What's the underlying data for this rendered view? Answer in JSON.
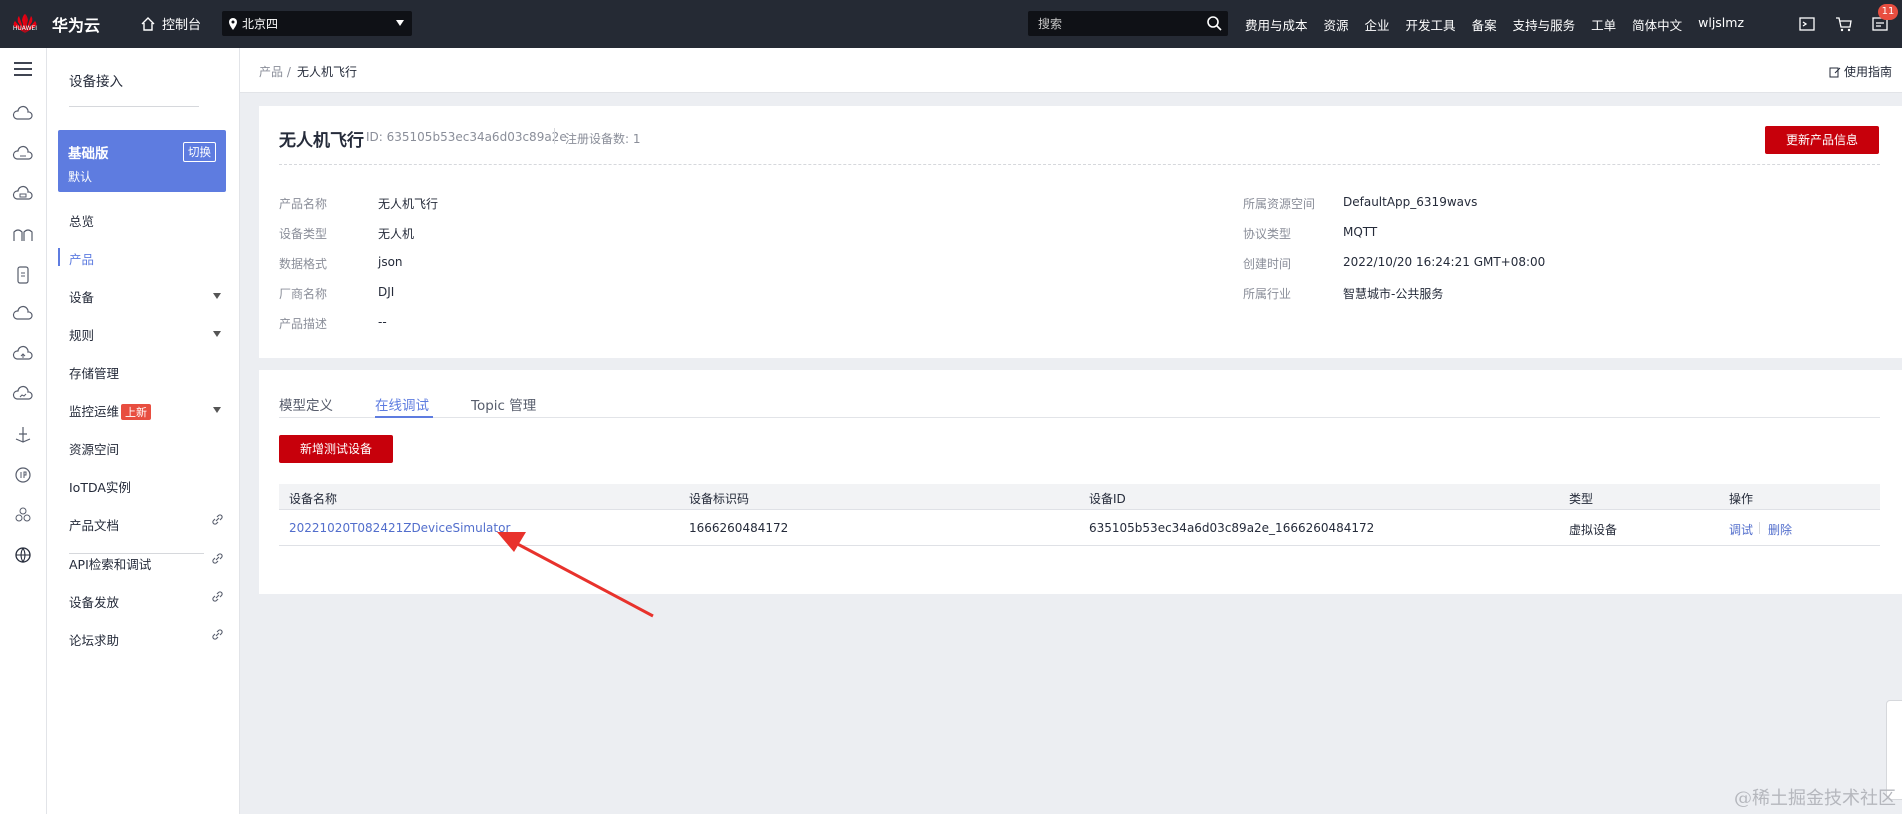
{
  "topbar": {
    "logo_text": "HUAWEI",
    "brand": "华为云",
    "console": "控制台",
    "region": "北京四",
    "search_placeholder": "搜索",
    "nav": [
      "费用与成本",
      "资源",
      "企业",
      "开发工具",
      "备案",
      "支持与服务",
      "工单",
      "简体中文",
      "wljslmz"
    ],
    "notification_count": "11"
  },
  "sidebar": {
    "title": "设备接入",
    "edition": {
      "name": "基础版",
      "switch": "切换",
      "sub": "默认"
    },
    "items": [
      {
        "label": "总览"
      },
      {
        "label": "产品"
      },
      {
        "label": "设备"
      },
      {
        "label": "规则"
      },
      {
        "label": "存储管理"
      },
      {
        "label": "监控运维",
        "tag": "上新"
      },
      {
        "label": "资源空间"
      },
      {
        "label": "IoTDA实例"
      },
      {
        "label": "产品文档"
      },
      {
        "label": "API检索和调试"
      },
      {
        "label": "设备发放"
      },
      {
        "label": "论坛求助"
      }
    ]
  },
  "breadcrumb": {
    "parent": "产品",
    "sep": "/",
    "current": "无人机飞行",
    "guide": "使用指南"
  },
  "product": {
    "title": "无人机飞行",
    "id_text": "ID: 635105b53ec34a6d03c89a2e",
    "device_count_text": "注册设备数: 1",
    "update_button": "更新产品信息",
    "left_fields": [
      {
        "label": "产品名称",
        "value": "无人机飞行"
      },
      {
        "label": "设备类型",
        "value": "无人机"
      },
      {
        "label": "数据格式",
        "value": "json"
      },
      {
        "label": "厂商名称",
        "value": "DJI"
      },
      {
        "label": "产品描述",
        "value": "--"
      }
    ],
    "right_fields": [
      {
        "label": "所属资源空间",
        "value": "DefaultApp_6319wavs"
      },
      {
        "label": "协议类型",
        "value": "MQTT"
      },
      {
        "label": "创建时间",
        "value": "2022/10/20 16:24:21 GMT+08:00"
      },
      {
        "label": "所属行业",
        "value": "智慧城市-公共服务"
      }
    ]
  },
  "tabs": [
    "模型定义",
    "在线调试",
    "Topic 管理"
  ],
  "debug": {
    "add_button": "新增测试设备",
    "columns": [
      "设备名称",
      "设备标识码",
      "设备ID",
      "类型",
      "操作"
    ],
    "rows": [
      {
        "name": "20221020T082421ZDeviceSimulator",
        "node_id": "1666260484172",
        "device_id": "635105b53ec34a6d03c89a2e_1666260484172",
        "type": "虚拟设备",
        "action_debug": "调试",
        "action_delete": "删除"
      }
    ]
  },
  "watermark": "@稀土掘金技术社区",
  "colors": {
    "topbar": "#252a34",
    "accent": "#5e7ce0",
    "brand_red": "#c7000b",
    "arrow": "#e8322c"
  }
}
